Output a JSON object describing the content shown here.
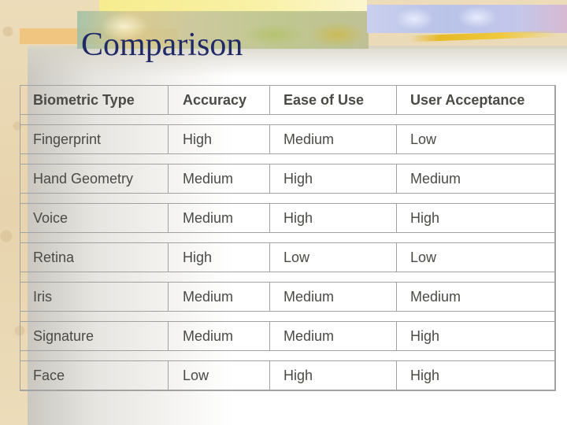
{
  "slide": {
    "title": "Comparison"
  },
  "table": {
    "headers": [
      "Biometric Type",
      "Accuracy",
      "Ease of Use",
      "User Acceptance"
    ],
    "rows": [
      [
        "Fingerprint",
        "High",
        "Medium",
        "Low"
      ],
      [
        "Hand Geometry",
        "Medium",
        "High",
        "Medium"
      ],
      [
        "Voice",
        "Medium",
        "High",
        "High"
      ],
      [
        "Retina",
        "High",
        "Low",
        "Low"
      ],
      [
        "Iris",
        "Medium",
        "Medium",
        "Medium"
      ],
      [
        "Signature",
        "Medium",
        "Medium",
        "High"
      ],
      [
        "Face",
        "Low",
        "High",
        "High"
      ]
    ]
  },
  "colors": {
    "title": "#1f2a66",
    "text": "#4a4a46",
    "border": "#a2a2a2",
    "parchment": "#e7d4ae"
  }
}
